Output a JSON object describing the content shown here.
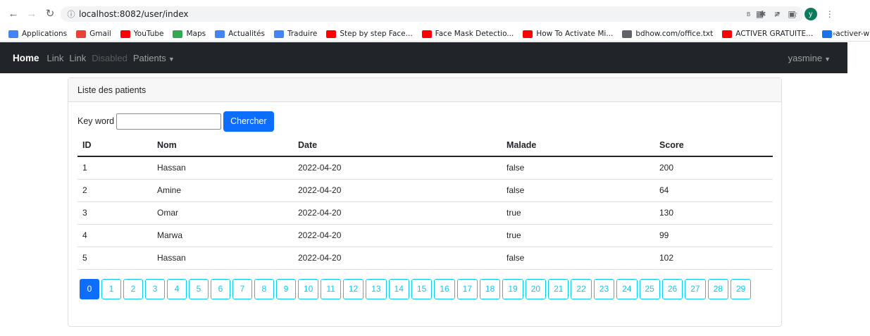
{
  "browser": {
    "url": "localhost:8082/user/index",
    "avatar_letter": "y",
    "bookmarks": [
      {
        "label": "Applications",
        "icon": "apps-grid-icon",
        "color": "#4285f4"
      },
      {
        "label": "Gmail",
        "icon": "gmail-icon",
        "color": "#ea4335"
      },
      {
        "label": "YouTube",
        "icon": "youtube-icon",
        "color": "#ff0000"
      },
      {
        "label": "Maps",
        "icon": "maps-icon",
        "color": "#34a853"
      },
      {
        "label": "Actualités",
        "icon": "news-icon",
        "color": "#4285f4"
      },
      {
        "label": "Traduire",
        "icon": "translate-icon",
        "color": "#4285f4"
      },
      {
        "label": "Step by step Face...",
        "icon": "youtube-icon",
        "color": "#ff0000"
      },
      {
        "label": "Face Mask Detectio...",
        "icon": "youtube-icon",
        "color": "#ff0000"
      },
      {
        "label": "How To Activate Mi...",
        "icon": "youtube-icon",
        "color": "#ff0000"
      },
      {
        "label": "bdhow.com/office.txt",
        "icon": "globe-icon",
        "color": "#5f6368"
      },
      {
        "label": "ACTIVER GRATUITE...",
        "icon": "youtube-icon",
        "color": "#ff0000"
      },
      {
        "label": "activer-windows",
        "icon": "bookmark-site-icon",
        "color": "#1a73e8"
      }
    ],
    "bookmarks_more": "»"
  },
  "navbar": {
    "brand": "Home",
    "links": [
      "Link",
      "Link"
    ],
    "disabled": "Disabled",
    "dropdown": "Patients",
    "user": "yasmine"
  },
  "card": {
    "title": "Liste des patients",
    "search_label": "Key word",
    "search_value": "",
    "search_button": "Chercher"
  },
  "table": {
    "headers": [
      "ID",
      "Nom",
      "Date",
      "Malade",
      "Score"
    ],
    "rows": [
      [
        "1",
        "Hassan",
        "2022-04-20",
        "false",
        "200"
      ],
      [
        "2",
        "Amine",
        "2022-04-20",
        "false",
        "64"
      ],
      [
        "3",
        "Omar",
        "2022-04-20",
        "true",
        "130"
      ],
      [
        "4",
        "Marwa",
        "2022-04-20",
        "true",
        "99"
      ],
      [
        "5",
        "Hassan",
        "2022-04-20",
        "false",
        "102"
      ]
    ]
  },
  "pagination": {
    "pages": [
      "0",
      "1",
      "2",
      "3",
      "4",
      "5",
      "6",
      "7",
      "8",
      "9",
      "10",
      "11",
      "12",
      "13",
      "14",
      "15",
      "16",
      "17",
      "18",
      "19",
      "20",
      "21",
      "22",
      "23",
      "24",
      "25",
      "26",
      "27",
      "28",
      "29"
    ],
    "active": "0"
  }
}
